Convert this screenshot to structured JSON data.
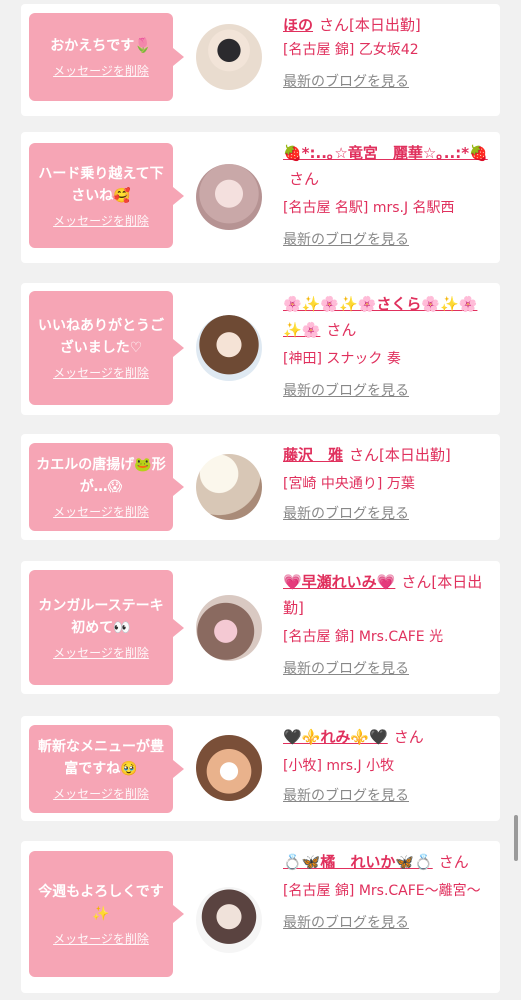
{
  "cards": [
    {
      "message": "おかえちです🌷",
      "delete_label": "メッセージを削除",
      "name": "ほの",
      "san": "さん",
      "status": "[本日出勤]",
      "store": "[名古屋 錦] 乙女坂42",
      "blog_link": "最新のブログを見る",
      "avatar_desc": "avatar-photo"
    },
    {
      "message": "ハード乗り越えて下さいね🥰",
      "delete_label": "メッセージを削除",
      "name": "🍓*:..｡☆竜宮　麗華☆｡..:*🍓",
      "san": "さん",
      "status": "",
      "store": "[名古屋 名駅] mrs.J 名駅西",
      "blog_link": "最新のブログを見る",
      "avatar_desc": "avatar-photo"
    },
    {
      "message": "いいねありがとうございました♡",
      "delete_label": "メッセージを削除",
      "name": "🌸✨🌸✨🌸さくら🌸✨🌸✨🌸",
      "san": "さん",
      "status": "",
      "store": "[神田] スナック 奏",
      "blog_link": "最新のブログを見る",
      "avatar_desc": "avatar-photo"
    },
    {
      "message": "カエルの唐揚げ🐸形が…😱",
      "delete_label": "メッセージを削除",
      "name": "藤沢　雅",
      "san": "さん",
      "status": "[本日出勤]",
      "store": "[宮崎 中央通り] 万葉",
      "blog_link": "最新のブログを見る",
      "avatar_desc": "avatar-photo"
    },
    {
      "message": "カンガルーステーキ初めて👀",
      "delete_label": "メッセージを削除",
      "name": "💗早瀬れいみ💗",
      "san": "さん",
      "status": "[本日出勤]",
      "store": "[名古屋 錦] Mrs.CAFE 光",
      "blog_link": "最新のブログを見る",
      "avatar_desc": "avatar-photo"
    },
    {
      "message": "斬新なメニューが豊富ですね🥹",
      "delete_label": "メッセージを削除",
      "name": "🖤⚜️れみ⚜️🖤",
      "san": "さん",
      "status": "",
      "store": "[小牧] mrs.J 小牧",
      "blog_link": "最新のブログを見る",
      "avatar_desc": "avatar-photo"
    },
    {
      "message": "今週もよろしくです✨",
      "delete_label": "メッセージを削除",
      "name": "💍🦋橘　れいか🦋💍",
      "san": "さん",
      "status": "",
      "store": "[名古屋 錦] Mrs.CAFE〜離宮〜",
      "blog_link": "最新のブログを見る",
      "avatar_desc": "avatar-photo"
    }
  ]
}
